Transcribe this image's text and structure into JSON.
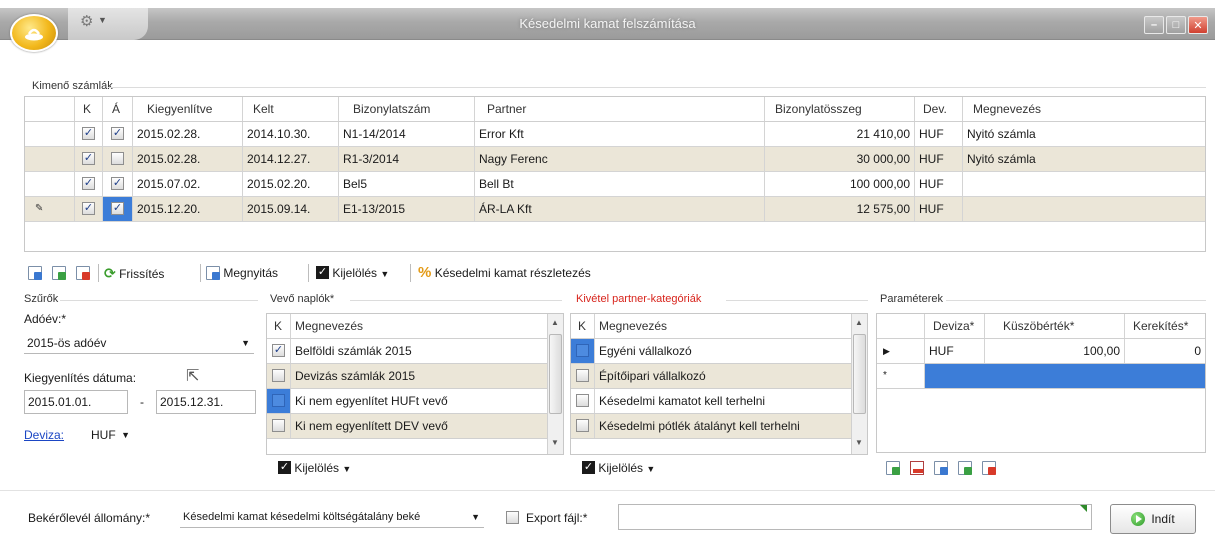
{
  "window": {
    "title": "Késedelmi kamat felszámítása"
  },
  "outgoing": {
    "group_label": "Kimenő számlák",
    "columns": [
      "K",
      "Á",
      "Kiegyenlítve",
      "Kelt",
      "Bizonylatszám",
      "Partner",
      "Bizonylatösszeg",
      "Dev.",
      "Megnevezés"
    ],
    "rows": [
      {
        "k": true,
        "a": true,
        "kiegyenlitve": "2015.02.28.",
        "kelt": "2014.10.30.",
        "bizonylatszam": "N1-14/2014",
        "partner": "Error Kft",
        "osszeg": "21 410,00",
        "dev": "HUF",
        "megnevezes": "Nyitó számla"
      },
      {
        "k": true,
        "a": false,
        "kiegyenlitve": "2015.02.28.",
        "kelt": "2014.12.27.",
        "bizonylatszam": "R1-3/2014",
        "partner": "Nagy Ferenc",
        "osszeg": "30 000,00",
        "dev": "HUF",
        "megnevezes": "Nyitó számla"
      },
      {
        "k": true,
        "a": true,
        "kiegyenlitve": "2015.07.02.",
        "kelt": "2015.02.20.",
        "bizonylatszam": "Bel5",
        "partner": "Bell Bt",
        "osszeg": "100 000,00",
        "dev": "HUF",
        "megnevezes": ""
      },
      {
        "k": true,
        "a": true,
        "kiegyenlitve": "2015.12.20.",
        "kelt": "2015.09.14.",
        "bizonylatszam": "E1-13/2015",
        "partner": "ÁR-LA Kft",
        "osszeg": "12 575,00",
        "dev": "HUF",
        "megnevezes": ""
      }
    ]
  },
  "toolbar": {
    "refresh": "Frissítés",
    "open": "Megnyitás",
    "select": "Kijelölés",
    "details": "Késedelmi kamat részletezés"
  },
  "filters": {
    "group_label": "Szűrők",
    "year_label": "Adóév:*",
    "year_value": "2015-ös adóév",
    "date_label": "Kiegyenlítés dátuma:",
    "date_from": "2015.01.01.",
    "date_sep": "-",
    "date_to": "2015.12.31.",
    "currency_label": "Deviza:",
    "currency_value": "HUF"
  },
  "customer_journals": {
    "group_label": "Vevő naplók*",
    "col_k": "K",
    "col_name": "Megnevezés",
    "items": [
      {
        "checked": true,
        "label": "Belföldi számlák 2015"
      },
      {
        "checked": false,
        "label": "Devizás számlák 2015"
      },
      {
        "checked": false,
        "label": "Ki nem egyenlítet HUFt vevő"
      },
      {
        "checked": false,
        "label": "Ki nem egyenlített DEV vevő"
      }
    ],
    "select_label": "Kijelölés"
  },
  "exceptions": {
    "group_label": "Kivétel partner-kategóriák",
    "col_k": "K",
    "col_name": "Megnevezés",
    "items": [
      {
        "checked": false,
        "label": "Egyéni vállalkozó"
      },
      {
        "checked": false,
        "label": "Építőipari vállalkozó"
      },
      {
        "checked": false,
        "label": "Késedelmi kamatot kell terhelni"
      },
      {
        "checked": false,
        "label": "Késedelmi pótlék átalányt kell terhelni"
      }
    ],
    "select_label": "Kijelölés"
  },
  "parameters": {
    "group_label": "Paraméterek",
    "columns": [
      "Deviza*",
      "Küszöbérték*",
      "Kerekítés*"
    ],
    "rows": [
      {
        "deviza": "HUF",
        "kuszob": "100,00",
        "kerekites": "0"
      }
    ]
  },
  "footer": {
    "letter_label": "Bekérőlevél állomány:*",
    "letter_value": "Késedelmi kamat késedelmi költségátalány beké",
    "export_label": "Export fájl:*",
    "export_value": "",
    "start_button": "Indít"
  },
  "colors": {
    "alt_row": "#ebe6d8",
    "selection": "#3c7dd8",
    "exception_label": "#d8241c",
    "link": "#1b46c4"
  }
}
